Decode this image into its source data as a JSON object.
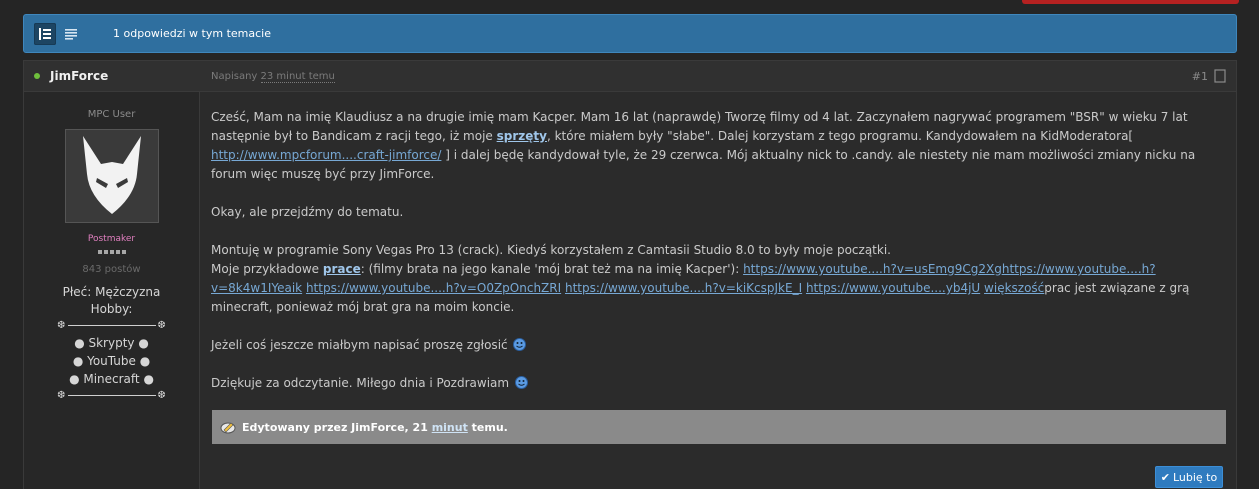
{
  "topic_bar": {
    "replies": "1 odpowiedzi w tym temacie"
  },
  "post": {
    "author": "JimForce",
    "posted_label": "Napisany",
    "posted_time": "23 minut temu",
    "post_number": "#1",
    "group_title": "MPC User",
    "rank": "Postmaker",
    "post_count": "843 postów",
    "custom_fields": {
      "gender": "Płeć: Mężczyzna",
      "hobby_label": "Hobby:",
      "divider_glyph": "❆",
      "hobbies": [
        "● Skrypty ●",
        "● YouTube ●",
        "● Minecraft ●"
      ]
    },
    "body": {
      "p1_a": "Cześć, Mam na imię Klaudiusz a na drugie imię mam Kacper. Mam 16 lat (naprawdę) Tworzę filmy od 4 lat. Zaczynałem nagrywać programem \"BSR\" w wieku 7 lat następnie był to Bandicam z racji tego, iż moje ",
      "p1_kw": "sprzęty",
      "p1_b": ", które miałem były \"słabe\". Dalej korzystam z tego programu.  Kandydowałem na KidModeratora[ ",
      "p1_link": "http://www.mpcforum....craft-jimforce/",
      "p1_c": " ] i dalej będę kandydował tyle, że 29 czerwca. Mój aktualny nick to .candy. ale niestety nie mam możliwości zmiany nicku na forum więc muszę być przy JimForce.",
      "p2": "Okay, ale przejdźmy do tematu.",
      "p3_a": "Montuję w programie Sony Vegas Pro 13 (crack). Kiedyś korzystałem z Camtasii Studio 8.0 to były moje początki.",
      "p3_b": "Moje przykładowe ",
      "p3_kw": "prace",
      "p3_c": ":  (filmy brata na jego kanale 'mój brat też ma na imię Kacper'): ",
      "p3_link1": "https://www.youtube....h?v=usEmg9Cg2Xg",
      "p3_link2": "https://www.youtube....h?v=8k4w1IYeaik",
      "p3_link3": "https://www.youtube....h?v=O0ZpOnchZRI",
      "p3_link4": "https://www.youtube....h?v=kiKcspJkE_I",
      "p3_link5": "https://www.youtube....yb4jU",
      "p3_link6": "większość",
      "p3_d": "prac jest związane z grą minecraft, ponieważ mój brat gra na moim koncie.",
      "p4": "Jeżeli coś jeszcze miałbym napisać proszę zgłosić",
      "p5": "Dziękuje za odczytanie. Miłego dnia i Pozdrawiam"
    },
    "edit": {
      "prefix": "Edytowany przez JimForce, 21 ",
      "minutes": "minut",
      "suffix": " temu."
    },
    "like_button": "Lubię to"
  }
}
